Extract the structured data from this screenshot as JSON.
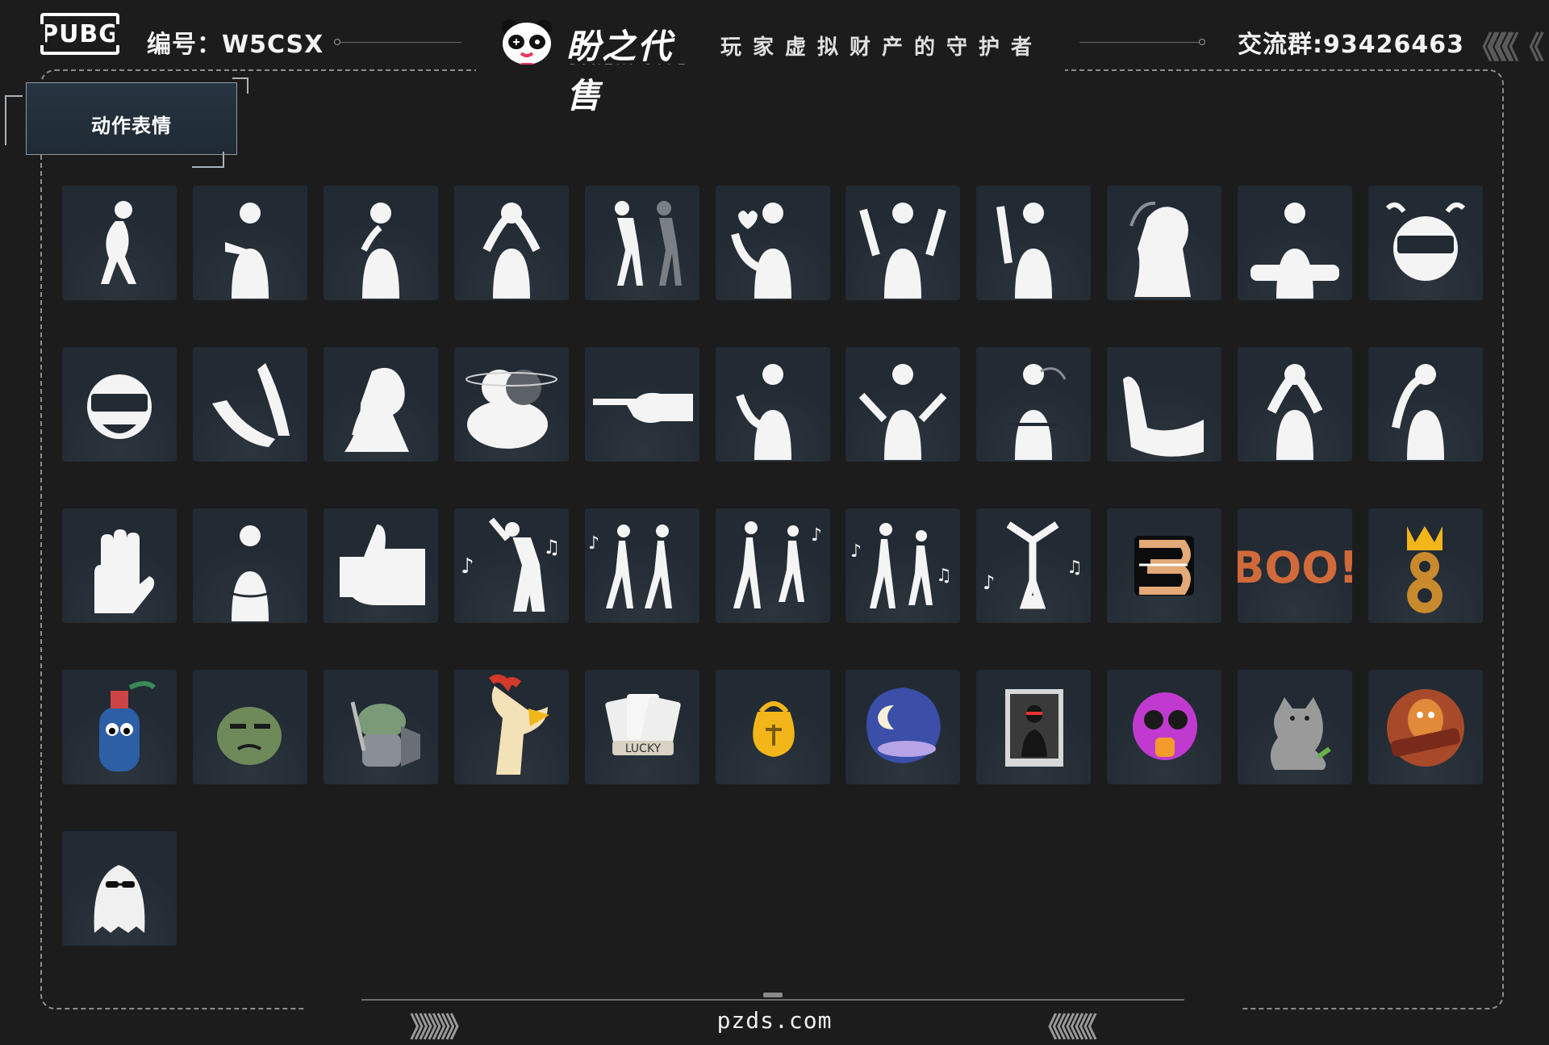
{
  "header": {
    "logo_text": "PUBG",
    "id_label": "编号：W5CSX",
    "brand_name": "盼之代售",
    "brand_sub": "PANZHI SALE",
    "slogan": "玩家虚拟财产的守护者",
    "group_label": "交流群:93426463",
    "right_chevrons": "《《《《 《"
  },
  "section": {
    "title": "动作表情"
  },
  "footer": {
    "domain": "pzds.com",
    "left_chevrons": "》》》》》",
    "right_chevrons": "《《《《《"
  },
  "tiles": [
    {
      "icon": "crouch-pose-icon"
    },
    {
      "icon": "pointing-pose-icon"
    },
    {
      "icon": "thinking-pose-icon"
    },
    {
      "icon": "cover-eyes-pose-icon"
    },
    {
      "icon": "walk-pose-icon"
    },
    {
      "icon": "heart-pose-icon"
    },
    {
      "icon": "hands-up-pose-icon"
    },
    {
      "icon": "wave-pose-icon"
    },
    {
      "icon": "head-turn-pose-icon"
    },
    {
      "icon": "lean-pose-icon"
    },
    {
      "icon": "angry-helmet-icon"
    },
    {
      "icon": "laughing-helmet-icon"
    },
    {
      "icon": "clap-hands-icon"
    },
    {
      "icon": "nose-pick-pose-icon"
    },
    {
      "icon": "dizzy-pose-icon"
    },
    {
      "icon": "point-hand-icon"
    },
    {
      "icon": "come-here-pose-icon"
    },
    {
      "icon": "shrug-pose-icon"
    },
    {
      "icon": "arms-crossed-pose-icon"
    },
    {
      "icon": "flex-arm-icon"
    },
    {
      "icon": "cry-pose-icon"
    },
    {
      "icon": "facepalm-pose-icon"
    },
    {
      "icon": "stop-hand-icon"
    },
    {
      "icon": "arms-folded-pose-icon"
    },
    {
      "icon": "thumbs-up-icon"
    },
    {
      "icon": "dance-solo-icon"
    },
    {
      "icon": "dance-duo-icon"
    },
    {
      "icon": "dance-duo-2-icon"
    },
    {
      "icon": "dance-duo-3-icon"
    },
    {
      "icon": "breakdance-icon"
    },
    {
      "icon": "number-3-sticker-icon"
    },
    {
      "icon": "boo-sticker-icon"
    },
    {
      "icon": "crown-8-sticker-icon"
    },
    {
      "icon": "spray-can-sticker-icon"
    },
    {
      "icon": "grumpy-frog-sticker-icon"
    },
    {
      "icon": "knight-frog-sticker-icon"
    },
    {
      "icon": "rooster-sticker-icon"
    },
    {
      "icon": "lucky-cards-sticker-icon"
    },
    {
      "icon": "coin-bag-sticker-icon"
    },
    {
      "icon": "night-moon-sticker-icon"
    },
    {
      "icon": "poster-sticker-icon"
    },
    {
      "icon": "gas-mask-sticker-icon"
    },
    {
      "icon": "cat-sticker-icon"
    },
    {
      "icon": "chicken-dinner-sticker-icon"
    },
    {
      "icon": "ghost-sticker-icon"
    }
  ]
}
